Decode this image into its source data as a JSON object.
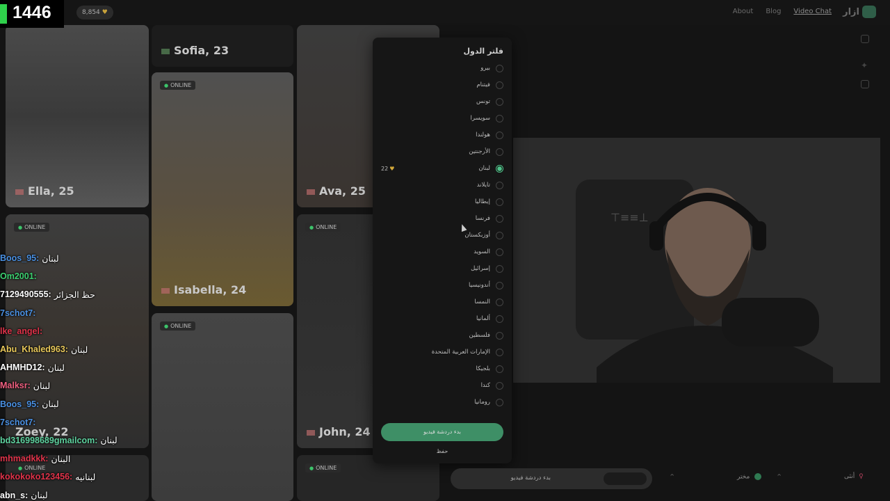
{
  "stream": {
    "viewer_count": "1446"
  },
  "topbar": {
    "coins": "8,854",
    "links": [
      "About",
      "Blog",
      "Video Chat"
    ],
    "active_link": "Video Chat",
    "brand": "ازار"
  },
  "cards": {
    "col1": [
      {
        "name": "Ella, 25"
      },
      {
        "name": "Zoey, 22"
      }
    ],
    "col2": [
      {
        "name": "Sofia, 23"
      },
      {
        "name": "Isabella, 24"
      }
    ],
    "col3": [
      {
        "name": "Ava, 25"
      },
      {
        "name": "John, 24"
      }
    ],
    "online_label": "ONLINE"
  },
  "chat": [
    {
      "user": "Boos_95:",
      "msg": "لبنان",
      "color": "#4a90e2"
    },
    {
      "user": "Om2001:",
      "msg": "",
      "color": "#3cd070"
    },
    {
      "user": "7129490555:",
      "msg": "حظ الجزائر",
      "color": "#ffffff"
    },
    {
      "user": "7schot7:",
      "msg": "",
      "color": "#4a90e2"
    },
    {
      "user": "lke_angel:",
      "msg": "",
      "color": "#e0334a"
    },
    {
      "user": "Abu_Khaled963:",
      "msg": "لبنان",
      "color": "#e8c85a"
    },
    {
      "user": "AHMHD12:",
      "msg": "لبنان",
      "color": "#ffffff"
    },
    {
      "user": "Malksr:",
      "msg": "لبنان",
      "color": "#f06080"
    },
    {
      "user": "Boos_95:",
      "msg": "لبنان",
      "color": "#4a90e2"
    },
    {
      "user": "7schot7:",
      "msg": "",
      "color": "#4a90e2"
    },
    {
      "user": "bd316998689gmailcom:",
      "msg": "لبنان",
      "color": "#5fd3a0"
    },
    {
      "user": "mhmadkkk:",
      "msg": "البنان",
      "color": "#e0334a"
    },
    {
      "user": "kokokoko123456:",
      "msg": "لبنانيه",
      "color": "#e0334a"
    },
    {
      "user": "abn_s:",
      "msg": "لبنان",
      "color": "#ffffff"
    }
  ],
  "filter": {
    "title": "فلتر الدول",
    "countries": [
      {
        "name": "بيرو",
        "checked": false
      },
      {
        "name": "فيتنام",
        "checked": false
      },
      {
        "name": "تونس",
        "checked": false
      },
      {
        "name": "سويسرا",
        "checked": false
      },
      {
        "name": "هولندا",
        "checked": false
      },
      {
        "name": "الأرجنتين",
        "checked": false
      },
      {
        "name": "لبنان",
        "checked": true,
        "cost": "22"
      },
      {
        "name": "تايلاند",
        "checked": false
      },
      {
        "name": "إيطاليا",
        "checked": false
      },
      {
        "name": "فرنسا",
        "checked": false
      },
      {
        "name": "أوزبكستان",
        "checked": false
      },
      {
        "name": "السويد",
        "checked": false
      },
      {
        "name": "إسرائيل",
        "checked": false
      },
      {
        "name": "أندونيسيا",
        "checked": false
      },
      {
        "name": "النمسا",
        "checked": false
      },
      {
        "name": "ألمانيا",
        "checked": false
      },
      {
        "name": "فلسطين",
        "checked": false
      },
      {
        "name": "الإمارات العربية المتحدة",
        "checked": false
      },
      {
        "name": "بلجيكا",
        "checked": false
      },
      {
        "name": "كندا",
        "checked": false
      },
      {
        "name": "رومانيا",
        "checked": false
      }
    ],
    "start_button": "بدء دردشة فيديو",
    "save": "حفظ"
  },
  "bottom": {
    "start_text": "بدء دردشة فيديو",
    "gender": "أنثى",
    "region": "مختر"
  },
  "colors": {
    "accent": "#3e8f66",
    "radio_checked": "#4fc48a",
    "gem": "#d4a93a"
  }
}
